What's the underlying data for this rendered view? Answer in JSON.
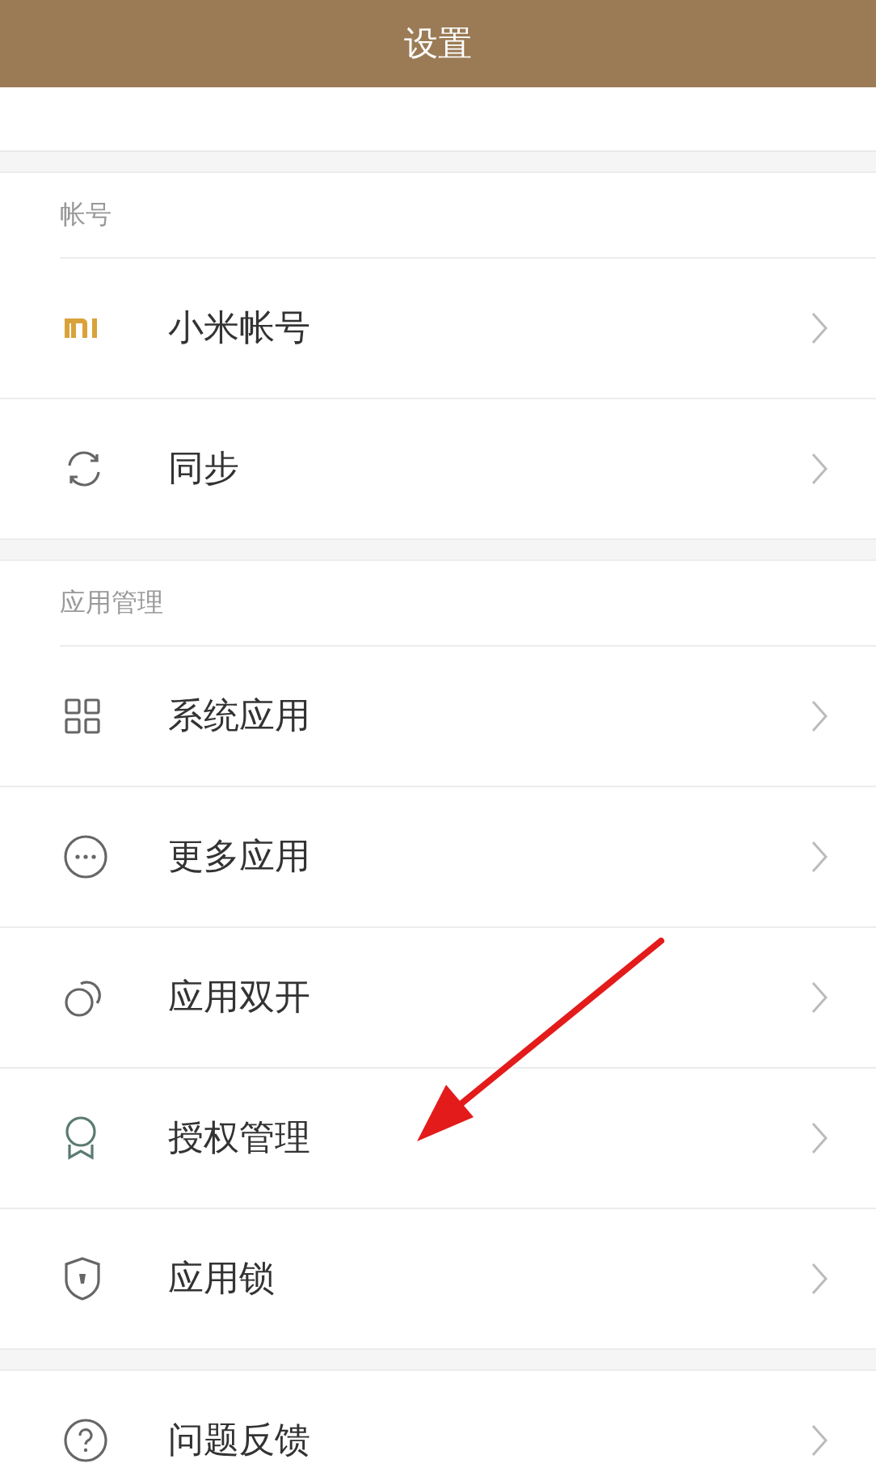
{
  "header": {
    "title": "设置"
  },
  "sections": [
    {
      "title": "帐号",
      "items": [
        {
          "kind": "mi",
          "label": "小米帐号"
        },
        {
          "kind": "sync",
          "label": "同步"
        }
      ]
    },
    {
      "title": "应用管理",
      "items": [
        {
          "kind": "grid",
          "label": "系统应用"
        },
        {
          "kind": "more",
          "label": "更多应用"
        },
        {
          "kind": "dual",
          "label": "应用双开"
        },
        {
          "kind": "badge",
          "label": "授权管理"
        },
        {
          "kind": "shield",
          "label": "应用锁"
        }
      ]
    },
    {
      "items": [
        {
          "kind": "help",
          "label": "问题反馈"
        }
      ]
    }
  ],
  "annotations": [
    {
      "kind": "arrow"
    }
  ]
}
